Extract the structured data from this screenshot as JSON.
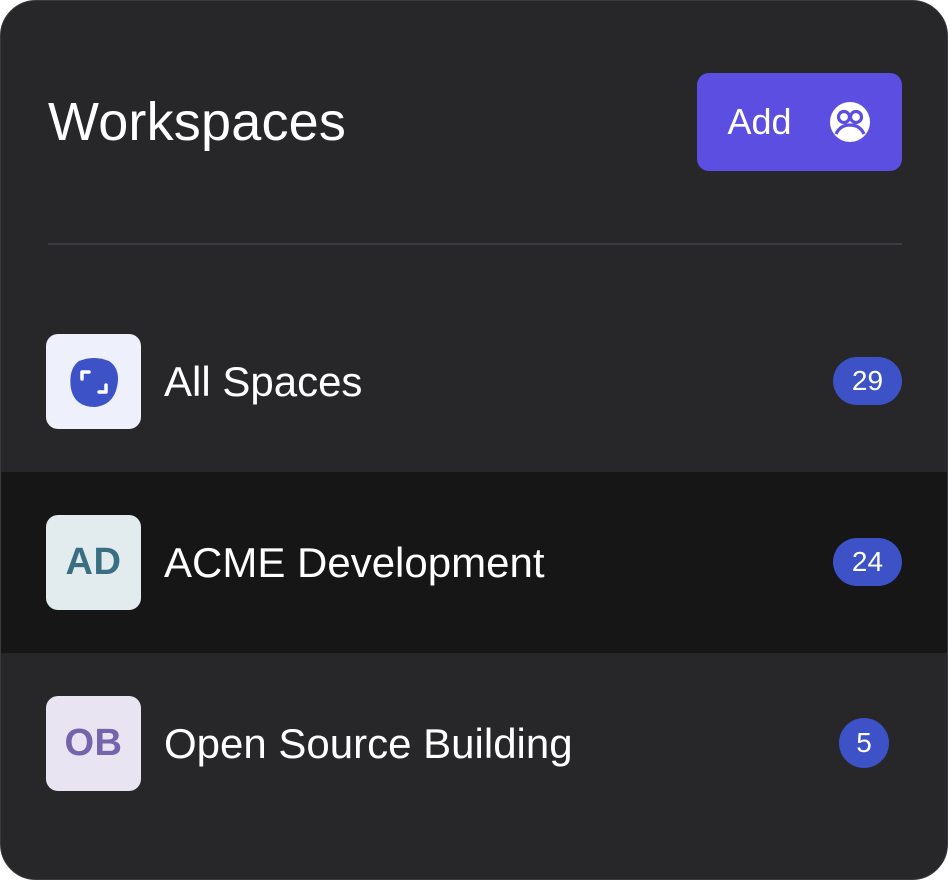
{
  "header": {
    "title": "Workspaces",
    "add_label": "Add",
    "add_icon": "users-circle-icon"
  },
  "workspaces": [
    {
      "icon": "focus-blob-icon",
      "label": "All Spaces",
      "count": "29",
      "active": false
    },
    {
      "initials": "AD",
      "label": "ACME Development",
      "count": "24",
      "active": true
    },
    {
      "initials": "OB",
      "label": "Open Source Building",
      "count": "5",
      "active": false
    }
  ],
  "colors": {
    "background": "#27272a",
    "active_row": "#161616",
    "accent_button": "#5b4ee0",
    "badge": "#3d52c6"
  }
}
